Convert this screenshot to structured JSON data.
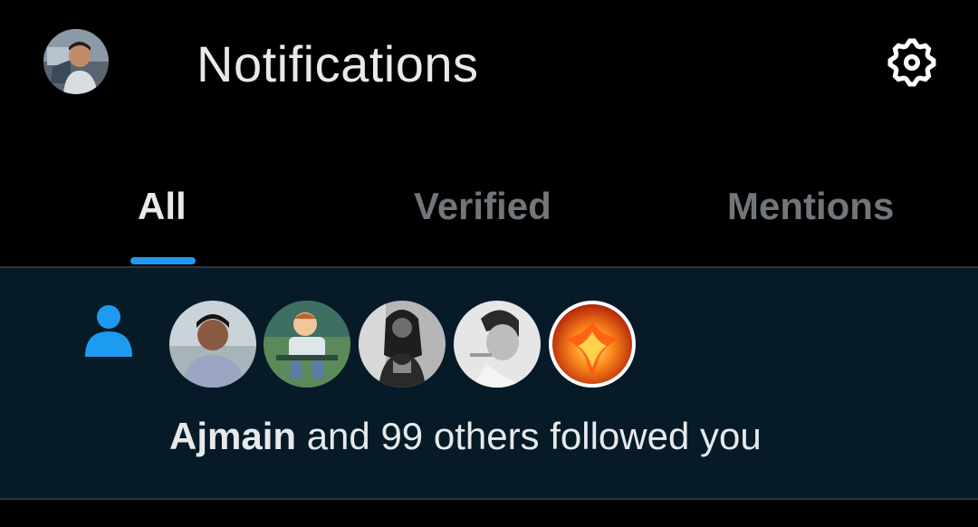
{
  "header": {
    "title": "Notifications",
    "profile_icon": "profile-avatar",
    "settings_icon": "gear-icon"
  },
  "tabs": [
    {
      "label": "All",
      "active": true
    },
    {
      "label": "Verified",
      "active": false
    },
    {
      "label": "Mentions",
      "active": false
    }
  ],
  "notification": {
    "icon": "person-icon",
    "name": "Ajmain",
    "text": " and 99 others followed you",
    "avatars": [
      "follower-avatar-1",
      "follower-avatar-2",
      "follower-avatar-3",
      "follower-avatar-4",
      "follower-avatar-5"
    ]
  },
  "colors": {
    "background": "#000000",
    "accent": "#1d9bf0",
    "text_primary": "#e7e9ea",
    "text_secondary": "#71767b",
    "unread_background": "#061a28",
    "divider": "#2f3336"
  }
}
